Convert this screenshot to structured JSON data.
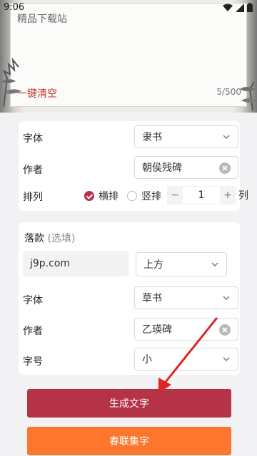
{
  "status_bar": {
    "time": "9:06"
  },
  "top_panel": {
    "text_value": "精品下载站",
    "clear_label": "一键清空",
    "counter": "5/500"
  },
  "card1": {
    "font_label": "字体",
    "font_value": "隶书",
    "author_label": "作者",
    "author_value": "朝侯残碑",
    "layout_label": "排列",
    "layout_options": [
      {
        "label": "横排",
        "checked": true
      },
      {
        "label": "竖排",
        "checked": false
      }
    ],
    "columns": {
      "minus": "−",
      "value": "1",
      "plus": "+",
      "unit": "列"
    }
  },
  "card2": {
    "title": "落款",
    "title_hint": "(选填)",
    "inscription_value": "j9p.com",
    "position_value": "上方",
    "font_label": "字体",
    "font_value": "草书",
    "author_label": "作者",
    "author_value": "乙瑛碑",
    "size_label": "字号",
    "size_value": "小"
  },
  "buttons": {
    "generate": "生成文字",
    "couplet": "春联集字"
  },
  "colors": {
    "accent": "#b53347",
    "orange": "#fc772d",
    "clear_text": "#c0392b"
  }
}
